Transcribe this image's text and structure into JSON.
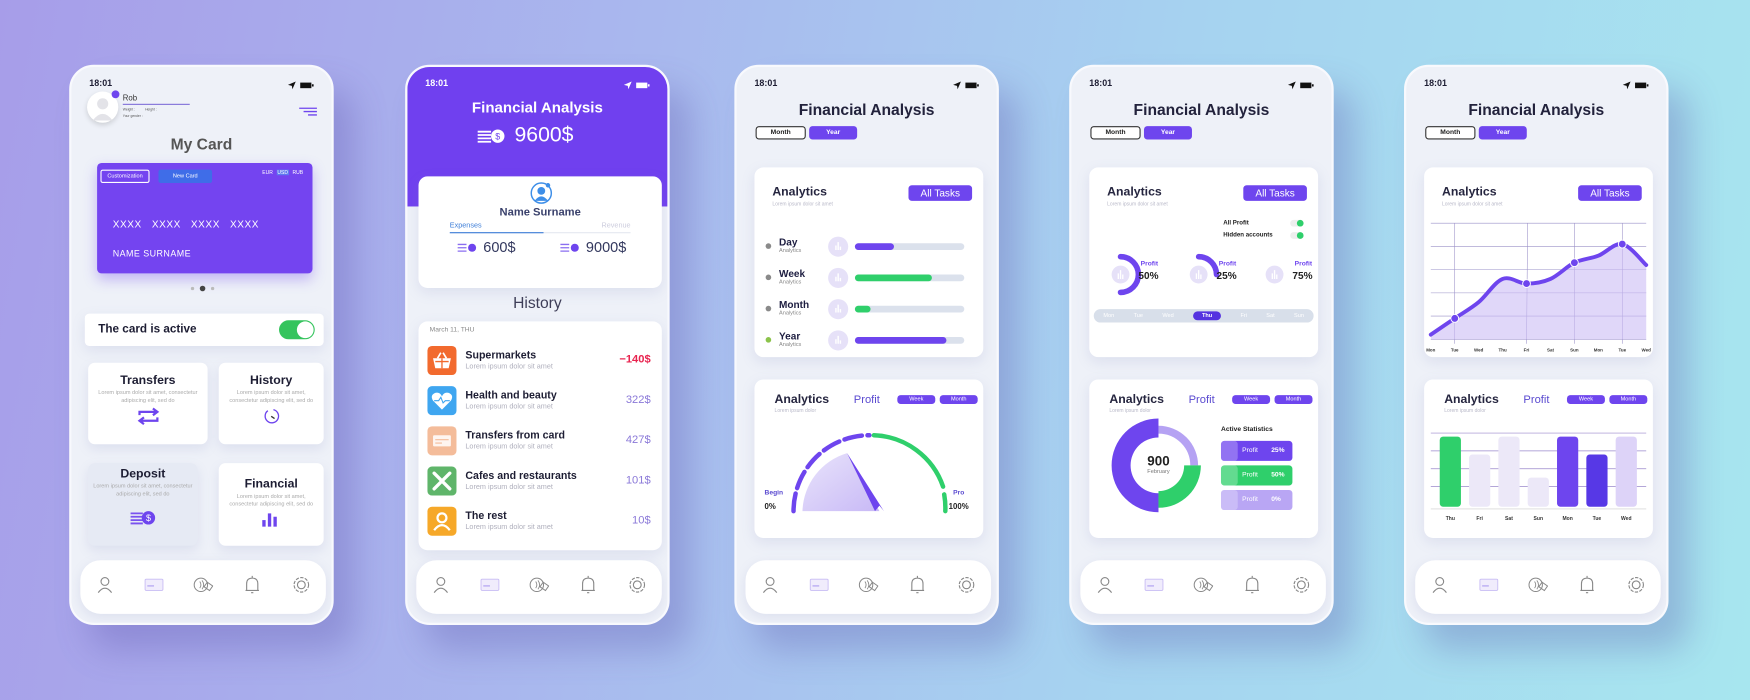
{
  "status": {
    "time": "18:01"
  },
  "colors": {
    "accent": "#6e45ee",
    "green": "#2fcf6b",
    "red": "#e8234f",
    "lavender": "#e3dcf8",
    "muted": "#8a78d8"
  },
  "nav": {
    "items": [
      {
        "icon": "user-icon"
      },
      {
        "icon": "card-icon"
      },
      {
        "icon": "contactless-pay-icon"
      },
      {
        "icon": "bell-icon"
      },
      {
        "icon": "settings-icon"
      }
    ]
  },
  "phone1": {
    "profile": {
      "name": "Rob",
      "weight": "Weight :",
      "height": "Height :",
      "gender": "Your gender :"
    },
    "title": "My Card",
    "card": {
      "customize": "Customization",
      "new_card": "New Card",
      "currencies": [
        "EUR",
        "USD",
        "RUB"
      ],
      "selected_currency": "USD",
      "number": [
        "XXXX",
        "XXXX",
        "XXXX",
        "XXXX"
      ],
      "holder": "NAME SURNAME",
      "page": 2,
      "pages": 3
    },
    "active": {
      "label": "The card is active",
      "on": true
    },
    "tiles": [
      {
        "title": "Transfers",
        "desc": "Lorem ipsum dolor sit amet, consectetur adipiscing elit, sed do",
        "icon": "transfer-icon"
      },
      {
        "title": "History",
        "desc": "Lorem ipsum dolor sit amet, consectetur adipiscing elit, sed do",
        "icon": "history-icon"
      },
      {
        "title": "Deposit",
        "desc": "Lorem ipsum dolor sit amet, consectetur adipiscing elit, sed do",
        "icon": "coins-icon"
      },
      {
        "title": "Financial",
        "desc": "Lorem ipsum dolor sit amet, consectetur adipiscing elit, sed do",
        "icon": "bar-chart-icon"
      }
    ]
  },
  "phone2": {
    "title": "Financial Analysis",
    "balance": "9600$",
    "user": "Name Surname",
    "tabs": [
      "Expenses",
      "Revenue"
    ],
    "selected_tab": "Expenses",
    "expenses": "600$",
    "revenue": "9000$",
    "history_title": "History",
    "date": "March 11, THU",
    "items": [
      {
        "title": "Supermarkets",
        "desc": "Lorem ipsum dolor sit amet",
        "amount": "−140$",
        "icon": "basket-icon",
        "color": "#f26a2e"
      },
      {
        "title": "Health and beauty",
        "desc": "Lorem ipsum dolor sit amet",
        "amount": "322$",
        "icon": "heart-pulse-icon",
        "color": "#3fa6f0"
      },
      {
        "title": "Transfers from card",
        "desc": "Lorem ipsum dolor sit amet",
        "amount": "427$",
        "icon": "card-transfer-icon",
        "color": "#f4bc9a"
      },
      {
        "title": "Cafes and restaurants",
        "desc": "Lorem ipsum dolor sit amet",
        "amount": "101$",
        "icon": "cutlery-icon",
        "color": "#5fb56a"
      },
      {
        "title": "The rest",
        "desc": "Lorem ipsum dolor sit amet",
        "amount": "10$",
        "icon": "person-icon",
        "color": "#f6a829"
      }
    ]
  },
  "phone3": {
    "title": "Financial Analysis",
    "periods": [
      "Month",
      "Year"
    ],
    "selected_period": "Year",
    "analytics": {
      "title": "Analytics",
      "subtitle": "Lorem ipsum dolor sit amet",
      "button": "All Tasks",
      "rows": [
        {
          "label": "Day",
          "sub": "Analytics",
          "progress": 0.36,
          "color": "#6e45ee",
          "dot": "#8a8a8a"
        },
        {
          "label": "Week",
          "sub": "Analytics",
          "progress": 0.7,
          "color": "#2fcf6b",
          "dot": "#8a8a8a"
        },
        {
          "label": "Month",
          "sub": "Analytics",
          "progress": 0.14,
          "color": "#2fcf6b",
          "dot": "#8a8a8a"
        },
        {
          "label": "Year",
          "sub": "Analytics",
          "progress": 0.84,
          "color": "#6e45ee",
          "dot": "#8bc34a"
        }
      ]
    },
    "gauge": {
      "title": "Analytics",
      "subtitle": "Lorem ipsum dolor",
      "tab": "Profit",
      "buttons": [
        "Week",
        "Month"
      ],
      "begin_label": "Begin",
      "begin_value": "0%",
      "end_label": "Pro",
      "end_value": "100%",
      "value_percent": 40
    }
  },
  "phone4": {
    "title": "Financial Analysis",
    "periods": [
      "Month",
      "Year"
    ],
    "selected_period": "Year",
    "analytics": {
      "title": "Analytics",
      "subtitle": "Lorem ipsum dolor sit amet",
      "button": "All Tasks",
      "toggles": [
        {
          "label": "All Profit",
          "on": true
        },
        {
          "label": "Hidden accounts",
          "on": true
        }
      ],
      "donuts": [
        {
          "label": "Profit",
          "value": "50%",
          "fraction": 0.5
        },
        {
          "label": "Profit",
          "value": "25%",
          "fraction": 0.25
        },
        {
          "label": "Profit",
          "value": "75%",
          "fraction": 0
        }
      ],
      "days": [
        "Mon",
        "Tue",
        "Wed",
        "Thu",
        "Fri",
        "Sat",
        "Sun"
      ],
      "selected_day": "Thu"
    },
    "stats": {
      "title": "Analytics",
      "subtitle": "Lorem ipsum dolor",
      "tab": "Profit",
      "buttons": [
        "Week",
        "Month"
      ],
      "center_value": "900",
      "center_label": "February",
      "list_title": "Active Statistics",
      "rows": [
        {
          "label": "Profit",
          "value": "25%",
          "color": "#6e45ee"
        },
        {
          "label": "Profit",
          "value": "50%",
          "color": "#2fcf6b"
        },
        {
          "label": "Profit",
          "value": "0%",
          "color": "#b9a6f4"
        }
      ]
    }
  },
  "phone5": {
    "title": "Financial Analysis",
    "periods": [
      "Month",
      "Year"
    ],
    "selected_period": "Year",
    "line_card": {
      "title": "Analytics",
      "subtitle": "Lorem ipsum dolor sit amet",
      "button": "All Tasks"
    },
    "bar_card": {
      "title": "Analytics",
      "subtitle": "Lorem ipsum dolor",
      "tab": "Profit",
      "buttons": [
        "Week",
        "Month"
      ]
    }
  },
  "chart_data": [
    {
      "type": "area",
      "categories": [
        "Mon",
        "Tue",
        "Wed",
        "Thu",
        "Fri",
        "Sat",
        "Sun",
        "Mon",
        "Tue",
        "Wed"
      ],
      "values": [
        0.2,
        0.9,
        1.6,
        2.6,
        2.4,
        2.6,
        3.3,
        3.6,
        4.1,
        3.2
      ],
      "highlighted": [
        "Tue",
        "Fri",
        "Sun",
        "Tue"
      ],
      "ylim": [
        0,
        5
      ],
      "grid": true,
      "color": "#6e45ee"
    },
    {
      "type": "bar",
      "categories": [
        "Thu",
        "Fri",
        "Sat",
        "Sun",
        "Mon",
        "Tue",
        "Wed"
      ],
      "values": [
        3.8,
        2.8,
        3.8,
        1.5,
        3.8,
        2.8,
        3.8
      ],
      "colors": [
        "#2fcf6b",
        "#ece8f8",
        "#ece8f8",
        "#ece8f8",
        "#6e45ee",
        "#5738e6",
        "#ddd3f8"
      ],
      "ylim": [
        0,
        4.5
      ],
      "grid": true
    }
  ]
}
